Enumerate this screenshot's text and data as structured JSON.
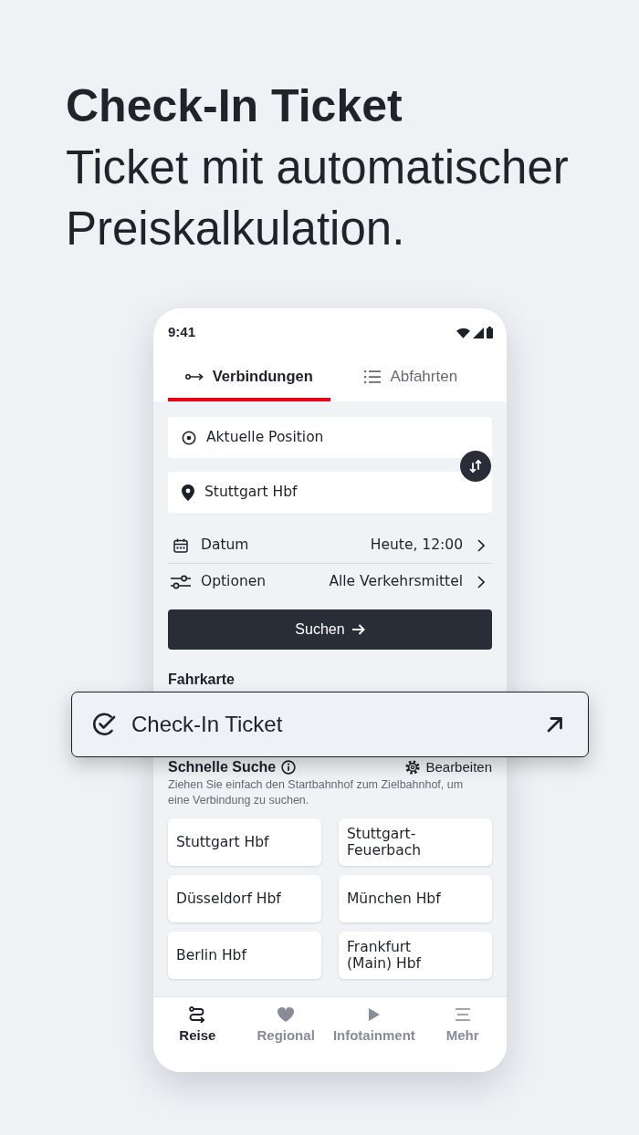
{
  "hero": {
    "title": "Check-In Ticket",
    "subtitle": "Ticket mit automatischer Preiskalkulation."
  },
  "status_bar": {
    "time": "9:41"
  },
  "tabs": [
    {
      "label": "Verbindungen",
      "selected": true
    },
    {
      "label": "Abfahrten",
      "selected": false
    }
  ],
  "search_form": {
    "origin": {
      "value": "Aktuelle Position"
    },
    "destination": {
      "value": "Stuttgart Hbf"
    },
    "settings": [
      {
        "label": "Datum",
        "value": "Heute, 12:00"
      },
      {
        "label": "Optionen",
        "value": "Alle Verkehrsmittel"
      }
    ],
    "search_button": "Suchen"
  },
  "ticket_section": {
    "title": "Fahrkarte"
  },
  "callout": {
    "label": "Check-In Ticket"
  },
  "quick_search": {
    "title": "Schnelle Suche",
    "edit_label": "Bearbeiten",
    "hint": "Ziehen Sie einfach den Startbahnhof zum Zielbahnhof, um eine Verbindung zu suchen.",
    "stations": [
      "Stuttgart Hbf",
      "Stuttgart-Feuerbach",
      "Düsseldorf Hbf",
      "München Hbf",
      "Berlin Hbf",
      "Frankfurt (Main) Hbf"
    ]
  },
  "bottom_nav": [
    {
      "label": "Reise",
      "selected": true
    },
    {
      "label": "Regional",
      "selected": false
    },
    {
      "label": "Infotainment",
      "selected": false
    },
    {
      "label": "Mehr",
      "selected": false
    }
  ]
}
